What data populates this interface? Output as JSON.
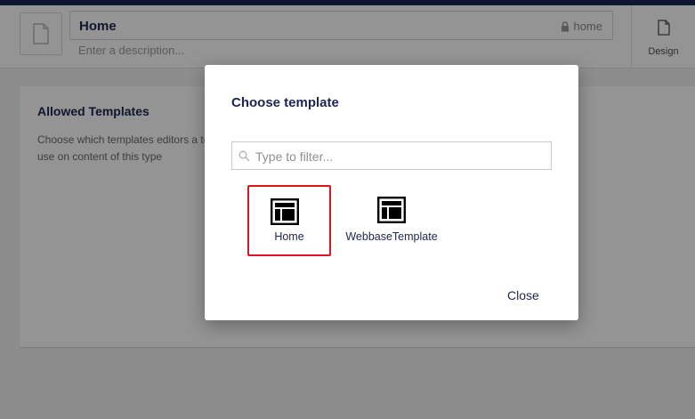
{
  "editor": {
    "name": "Home",
    "alias": "home",
    "description_placeholder": "Enter a description...",
    "tabs": [
      {
        "label": "Design",
        "icon": "document-icon"
      }
    ]
  },
  "panel": {
    "title": "Allowed Templates",
    "description": "Choose which templates editors a to use on content of this type"
  },
  "dialog": {
    "title": "Choose template",
    "filter_placeholder": "Type to filter...",
    "templates": [
      {
        "label": "Home",
        "icon": "layout-icon",
        "selected": true
      },
      {
        "label": "WebbaseTemplate",
        "icon": "layout-icon",
        "selected": false
      }
    ],
    "close_label": "Close"
  },
  "colors": {
    "primary_text": "#1b264f",
    "highlight": "#e0141e",
    "topbar": "#1b264f"
  }
}
